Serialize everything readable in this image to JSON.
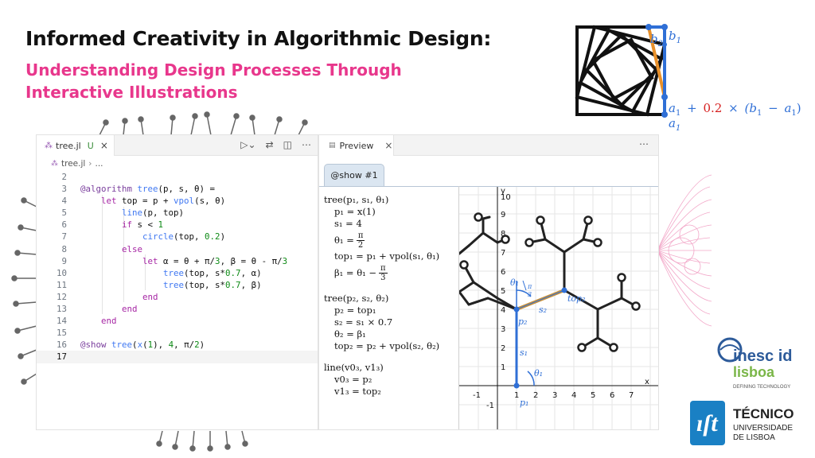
{
  "slide": {
    "title": "Informed Creativity in Algorithmic Design:",
    "subtitle_line1": "Understanding Design Processes Through",
    "subtitle_line2": "Interactive Illustrations",
    "title_color": "#111111",
    "subtitle_color": "#e8378c"
  },
  "squares_figure": {
    "labels": {
      "b2": "b",
      "b2_sub": "2",
      "b1": "b",
      "b1_sub": "1",
      "a1": "a",
      "a1_sub": "1"
    },
    "formula": {
      "a": "a",
      "a_sub": "1",
      "plus": "+",
      "coef": "0.2",
      "times": "×",
      "paren_open": "(b",
      "b_sub": "1",
      "minus": "−",
      "a2": "a",
      "a2_sub": "1",
      "paren_close": ")"
    },
    "colors": {
      "blue": "#2f6fd6",
      "orange": "#e8902a",
      "red": "#d62020"
    }
  },
  "editor": {
    "tab": {
      "file_icon": "julia-file-icon",
      "filename": "tree.jl",
      "status": "U",
      "close": "×"
    },
    "actions": [
      "run-icon",
      "chevron-down-icon",
      "diff-icon",
      "split-icon",
      "more-icon"
    ],
    "breadcrumb": {
      "file": "tree.jl",
      "rest": "..."
    },
    "active_line": "17",
    "lines": [
      {
        "n": "2"
      },
      {
        "n": "3"
      },
      {
        "n": "4"
      },
      {
        "n": "5"
      },
      {
        "n": "6"
      },
      {
        "n": "7"
      },
      {
        "n": "8"
      },
      {
        "n": "9"
      },
      {
        "n": "10"
      },
      {
        "n": "11"
      },
      {
        "n": "12"
      },
      {
        "n": "13"
      },
      {
        "n": "14"
      },
      {
        "n": "15"
      },
      {
        "n": "16"
      },
      {
        "n": "17"
      }
    ],
    "code": {
      "l3_macro": "@algorithm",
      "l3_fn": "tree",
      "l3_rest": "(p, s, θ) =",
      "l4_kw": "let",
      "l4_rest": " top = p + ",
      "l4_fn": "vpol",
      "l4_end": "(s, θ)",
      "l5_fn": "line",
      "l5_rest": "(p, top)",
      "l6_kw": "if",
      "l6_rest": " s < ",
      "l6_num": "1",
      "l7_fn": "circle",
      "l7_rest": "(top, ",
      "l7_num": "0.2",
      "l7_end": ")",
      "l8_kw": "else",
      "l9_kw": "let",
      "l9_rest": " α = θ + π/",
      "l9_num1": "3",
      "l9_mid": ", β = θ - π/",
      "l9_num2": "3",
      "l10_fn": "tree",
      "l10_rest": "(top, s*",
      "l10_num": "0.7",
      "l10_end": ", α)",
      "l11_fn": "tree",
      "l11_rest": "(top, s*",
      "l11_num": "0.7",
      "l11_end": ", β)",
      "l12_kw": "end",
      "l13_kw": "end",
      "l14_kw": "end",
      "l16_macro": "@show",
      "l16_fn": "tree",
      "l16_rest": "(",
      "l16_fn2": "x",
      "l16_mid": "(",
      "l16_num1": "1",
      "l16_mid2": "), ",
      "l16_num2": "4",
      "l16_end": ", π/",
      "l16_num3": "2",
      "l16_close": ")"
    }
  },
  "preview": {
    "tab_label": "Preview",
    "tab_close": "×",
    "more": "⋯",
    "show_tab": "@show #1",
    "math": {
      "h1": "tree(p₁, s₁, θ₁)",
      "r1": "p₁ = x(1)",
      "r2": "s₁ = 4",
      "r3_lhs": "θ₁ =",
      "r3_num": "π",
      "r3_den": "2",
      "r4": "top₁ = p₁ + vpol(s₁, θ₁)",
      "r5_lhs": "β₁ = θ₁ −",
      "r5_num": "π",
      "r5_den": "3",
      "h2": "tree(p₂, s₂, θ₂)",
      "r6": "p₂ = top₁",
      "r7": "s₂ = s₁ × 0.7",
      "r8": "θ₂ = β₁",
      "r9": "top₂ = p₂ + vpol(s₂, θ₂)",
      "h3": "line(v0₃, v1₃)",
      "r10": "v0₃ = p₂",
      "r11": "v1₃ = top₂"
    },
    "plot": {
      "x_ticks": [
        "-1",
        "1",
        "2",
        "3",
        "4",
        "5",
        "6",
        "7"
      ],
      "y_ticks": [
        "-1",
        "1",
        "2",
        "3",
        "4",
        "5",
        "6",
        "7",
        "8",
        "9",
        "10"
      ],
      "x_axis": "x",
      "y_axis": "y",
      "labels": {
        "p1": "p₁",
        "s1": "s₁",
        "theta1": "θ₁",
        "p2": "p₂",
        "s2": "s₂",
        "theta1b": "θ₁",
        "top2": "top₂",
        "pi3_num": "π",
        "pi3_den": "3"
      }
    }
  },
  "logos": {
    "inesc_main": "inesc id",
    "inesc_sub": "lisboa",
    "inesc_tag": "DEFINING TECHNOLOGY",
    "tecnico_main": "TÉCNICO",
    "tecnico_sub1": "UNIVERSIDADE",
    "tecnico_sub2": "DE LISBOA"
  }
}
